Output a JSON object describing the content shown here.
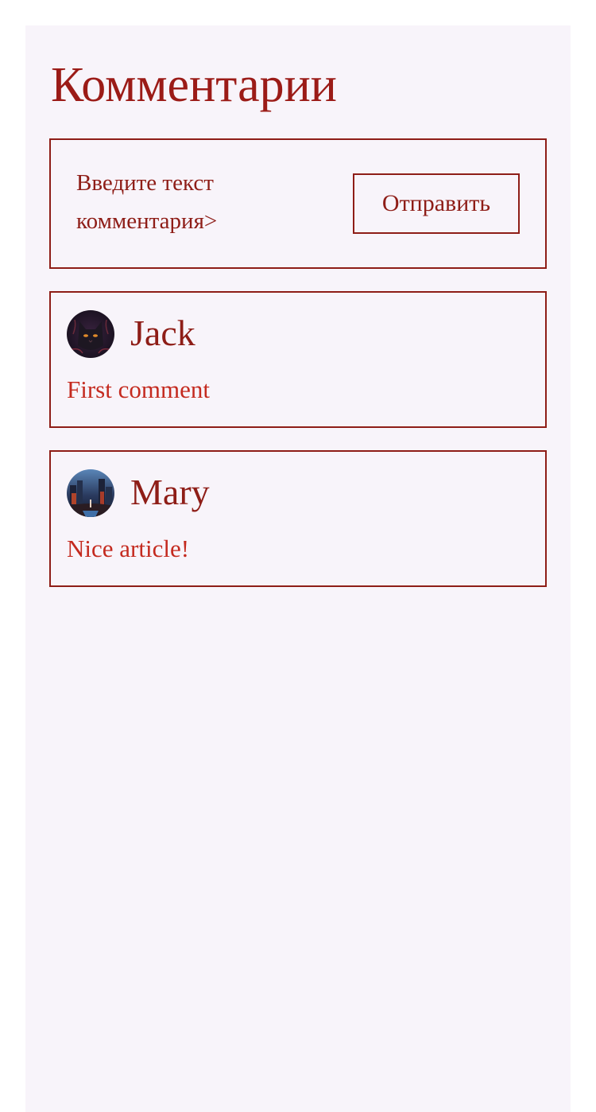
{
  "page": {
    "title": "Комментарии"
  },
  "form": {
    "placeholder": "Введите текст комментария>",
    "submit_label": "Отправить"
  },
  "comments": [
    {
      "author": "Jack",
      "text": "First comment",
      "avatar_icon": "black-cat-avatar"
    },
    {
      "author": "Mary",
      "text": "Nice article!",
      "avatar_icon": "night-city-avatar"
    }
  ],
  "colors": {
    "accent": "#9b1b17",
    "comment_text": "#c42a1f",
    "panel_background": "#f8f4fa"
  }
}
